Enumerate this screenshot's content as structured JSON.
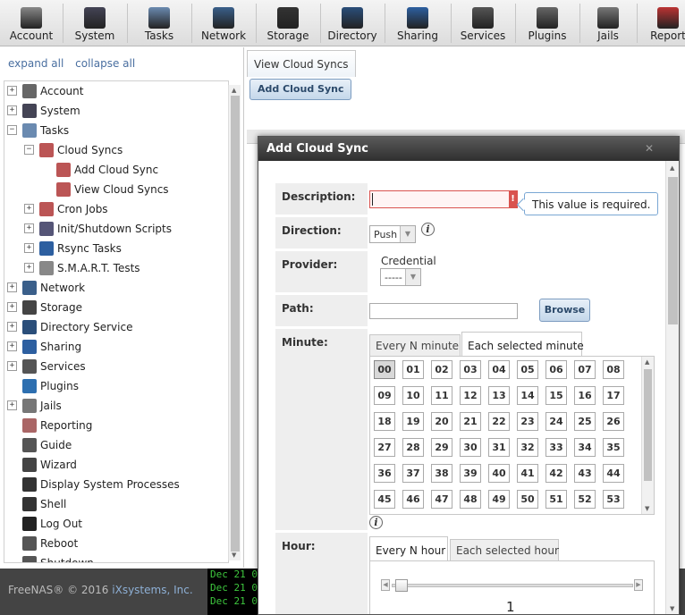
{
  "toolbar": [
    {
      "label": "Account",
      "icon": "account-icon"
    },
    {
      "label": "System",
      "icon": "system-icon"
    },
    {
      "label": "Tasks",
      "icon": "tasks-icon"
    },
    {
      "label": "Network",
      "icon": "network-icon"
    },
    {
      "label": "Storage",
      "icon": "storage-icon"
    },
    {
      "label": "Directory",
      "icon": "directory-icon"
    },
    {
      "label": "Sharing",
      "icon": "sharing-icon"
    },
    {
      "label": "Services",
      "icon": "services-icon"
    },
    {
      "label": "Plugins",
      "icon": "plugins-icon"
    },
    {
      "label": "Jails",
      "icon": "jails-icon"
    },
    {
      "label": "Report",
      "icon": "reporting-icon"
    }
  ],
  "nav": {
    "expand_all": "expand all",
    "collapse_all": "collapse all",
    "items": [
      {
        "label": "Account",
        "expander": "+"
      },
      {
        "label": "System",
        "expander": "+"
      },
      {
        "label": "Tasks",
        "expander": "−"
      },
      {
        "label": "Cloud Syncs",
        "expander": "−"
      },
      {
        "label": "Add Cloud Sync",
        "expander": ""
      },
      {
        "label": "View Cloud Syncs",
        "expander": ""
      },
      {
        "label": "Cron Jobs",
        "expander": "+"
      },
      {
        "label": "Init/Shutdown Scripts",
        "expander": "+"
      },
      {
        "label": "Rsync Tasks",
        "expander": "+"
      },
      {
        "label": "S.M.A.R.T. Tests",
        "expander": "+"
      },
      {
        "label": "Network",
        "expander": "+"
      },
      {
        "label": "Storage",
        "expander": "+"
      },
      {
        "label": "Directory Service",
        "expander": "+"
      },
      {
        "label": "Sharing",
        "expander": "+"
      },
      {
        "label": "Services",
        "expander": "+"
      },
      {
        "label": "Plugins",
        "expander": ""
      },
      {
        "label": "Jails",
        "expander": "+"
      },
      {
        "label": "Reporting",
        "expander": ""
      },
      {
        "label": "Guide",
        "expander": ""
      },
      {
        "label": "Wizard",
        "expander": ""
      },
      {
        "label": "Display System Processes",
        "expander": ""
      },
      {
        "label": "Shell",
        "expander": ""
      },
      {
        "label": "Log Out",
        "expander": ""
      },
      {
        "label": "Reboot",
        "expander": ""
      },
      {
        "label": "Shutdown",
        "expander": ""
      }
    ]
  },
  "content": {
    "tab_label": "View Cloud Syncs",
    "add_button": "Add Cloud Sync"
  },
  "dialog": {
    "title": "Add Cloud Sync",
    "close": "✕",
    "description_label": "Description:",
    "description_value": "",
    "error_marker": "!",
    "tooltip": "This value is required.",
    "direction_label": "Direction:",
    "direction_value": "Push",
    "provider_label": "Provider:",
    "credential_label": "Credential",
    "credential_value": "-----",
    "path_label": "Path:",
    "path_value": "",
    "browse_button": "Browse",
    "minute_label": "Minute:",
    "minute_tabs": [
      "Every N minute",
      "Each selected minute"
    ],
    "minutes": [
      "00",
      "01",
      "02",
      "03",
      "04",
      "05",
      "06",
      "07",
      "08",
      "09",
      "10",
      "11",
      "12",
      "13",
      "14",
      "15",
      "16",
      "17",
      "18",
      "19",
      "20",
      "21",
      "22",
      "23",
      "24",
      "25",
      "26",
      "27",
      "28",
      "29",
      "30",
      "31",
      "32",
      "33",
      "34",
      "35",
      "36",
      "37",
      "38",
      "39",
      "40",
      "41",
      "42",
      "43",
      "44",
      "45",
      "46",
      "47",
      "48",
      "49",
      "50",
      "51",
      "52",
      "53"
    ],
    "selected_minute": "00",
    "hour_label": "Hour:",
    "hour_tabs": [
      "Every N hour",
      "Each selected hour"
    ],
    "hour_slider_value": "1"
  },
  "footer": {
    "copyright": "FreeNAS® © 2016",
    "company": "iXsystems, Inc.",
    "console_lines": [
      "Dec 21 0",
      "Dec 21 0",
      "Dec 21 0"
    ]
  },
  "colors": {
    "error": "#d9534f",
    "accent": "#7c9cc0",
    "console_text": "#3ec83e"
  }
}
